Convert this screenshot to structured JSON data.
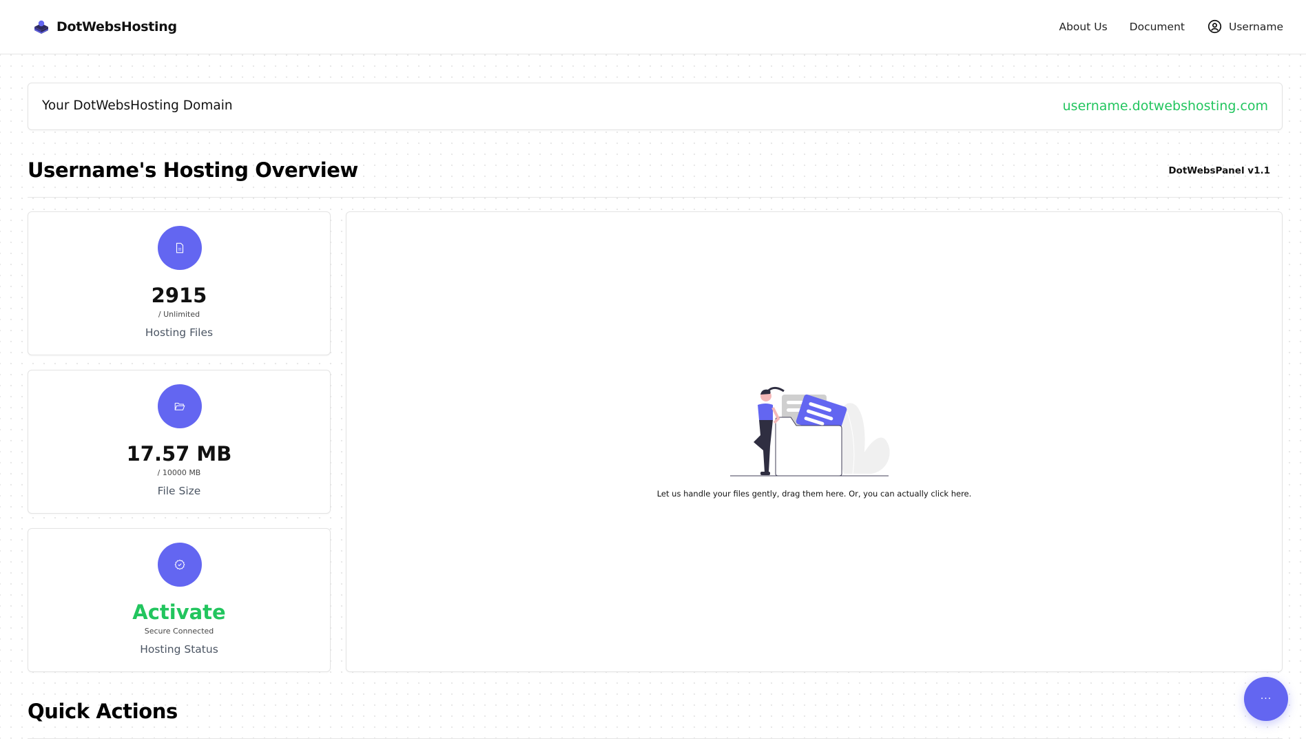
{
  "header": {
    "brand": "DotWebsHosting",
    "nav": {
      "about": "About Us",
      "document": "Document",
      "user": "Username"
    }
  },
  "domain": {
    "label": "Your DotWebsHosting Domain",
    "value": "username.dotwebshosting.com"
  },
  "overview": {
    "title": "Username's Hosting Overview",
    "version": "DotWebsPanel v1.1"
  },
  "stats": [
    {
      "icon": "file-icon",
      "value": "2915",
      "sub": "/ Unlimited",
      "label": "Hosting Files"
    },
    {
      "icon": "folder-open-icon",
      "value": "17.57 MB",
      "sub": "/ 10000 MB",
      "label": "File Size"
    },
    {
      "icon": "badge-check-icon",
      "value": "Activate",
      "sub": "Secure Connected",
      "label": "Hosting Status"
    }
  ],
  "dropzone": {
    "text": "Let us handle your files gently, drag them here. Or, you can actually click here."
  },
  "quick_actions": {
    "title": "Quick Actions"
  },
  "fab": {
    "label": "···"
  },
  "colors": {
    "accent": "#6366f1",
    "success": "#22c55e"
  }
}
